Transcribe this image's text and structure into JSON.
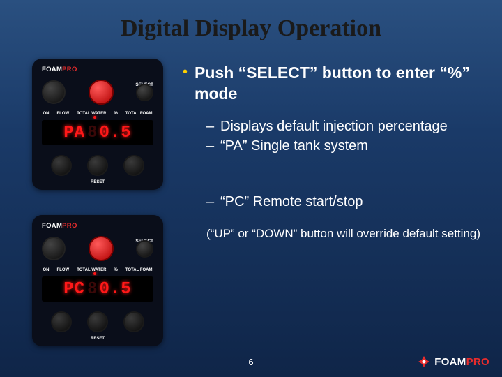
{
  "title": "Digital Display Operation",
  "panel": {
    "brand_foam": "FOAM",
    "brand_pro": "PRO",
    "label_foam": "FOAM",
    "label_select": "SELECT",
    "label_on": "ON",
    "label_flow": "FLOW",
    "label_total": "TOTAL WATER",
    "label_pct": "%",
    "label_tfoam": "TOTAL FOAM",
    "label_reset": "RESET",
    "display1_seg": "PA",
    "display1_val": "0.5",
    "display2_seg": "PC",
    "display2_val": "0.5"
  },
  "bullets": {
    "main": "Push “SELECT” button to enter “%” mode",
    "sub1": "Displays default injection percentage",
    "sub2": "“PA” Single tank system",
    "sub3": "“PC” Remote start/stop",
    "note": "(“UP” or “DOWN” button will override default setting)"
  },
  "page": "6",
  "logo": {
    "foam": "FOAM",
    "pro": "PRO"
  }
}
